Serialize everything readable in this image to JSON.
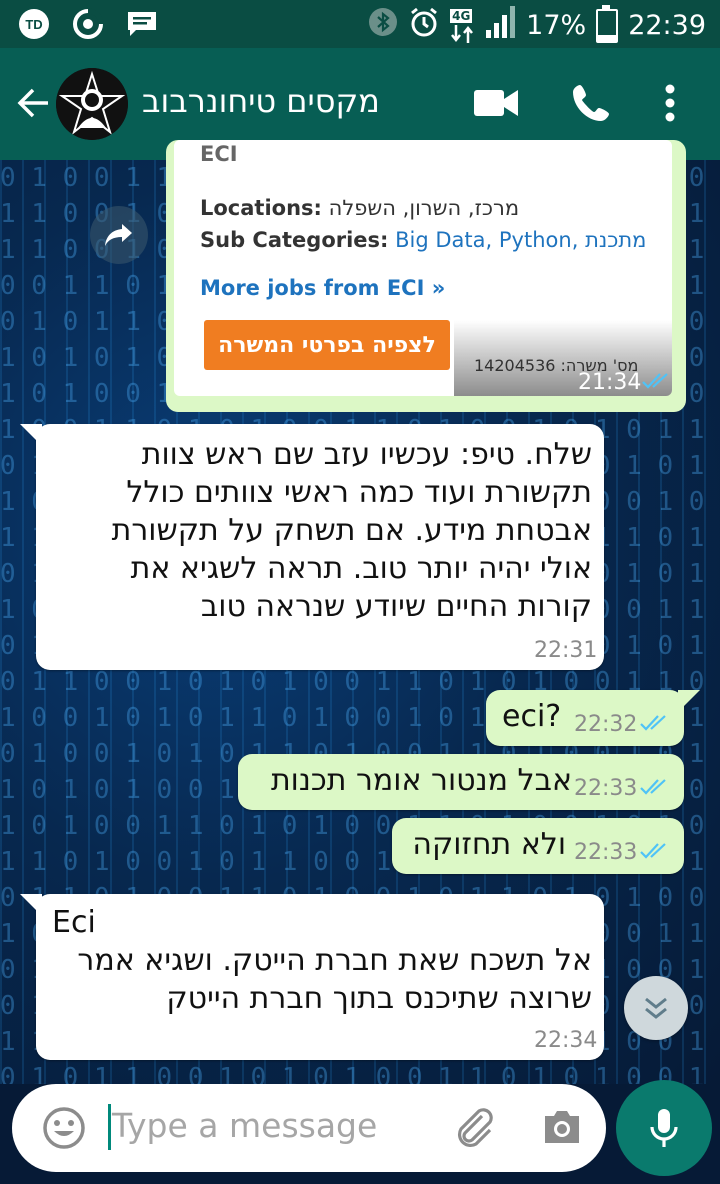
{
  "status_bar": {
    "battery_percent": "17%",
    "battery_level": 0.17,
    "time": "22:39",
    "network_label": "4G",
    "left_icons": [
      "app-notification-icon",
      "sync-icon",
      "message-icon"
    ],
    "right_icons": [
      "bluetooth-icon",
      "alarm-icon",
      "4g-data-icon",
      "signal-icon",
      "battery-icon"
    ]
  },
  "header": {
    "contact_name": "מקסים טיחונרבוב",
    "icons": [
      "back-arrow-icon",
      "avatar",
      "video-call-icon",
      "phone-call-icon",
      "more-options-icon"
    ]
  },
  "job_card": {
    "top_cut_text": "ECI",
    "locations_label": "Locations:",
    "locations_value": "מרכז, השרון, השפלה",
    "subcat_label": "Sub Categories:",
    "subcat_values": [
      "Big Data",
      "Python",
      "מתכנת"
    ],
    "more_jobs": "More jobs from ECI »",
    "apply_button": "לצפיה בפרטי המשרה",
    "job_id": "מס' משרה: 14204536",
    "time": "21:34"
  },
  "messages": [
    {
      "direction": "in",
      "text": "שלח. טיפ: עכשיו עזב שם ראש צוות תקשורת ועוד כמה ראשי צוותים כולל אבטחת מידע. אם תשחק על תקשורת אולי יהיה יותר טוב. תראה לשגיא את קורות החיים שיודע שנראה טוב",
      "time": "22:31"
    },
    {
      "direction": "out",
      "text": "eci?",
      "time": "22:32"
    },
    {
      "direction": "out",
      "text": "אבל מנטור אומר תכנות",
      "time": "22:33"
    },
    {
      "direction": "out",
      "text": "ולא תחזוקה",
      "time": "22:33"
    },
    {
      "direction": "in",
      "text_first": "Eci",
      "text": "אל תשכח שאת חברת הייטק. ושגיא אמר שרוצה שתיכנס בתוך חברת הייטק",
      "time": "22:34"
    }
  ],
  "input": {
    "placeholder": "Type a message"
  },
  "colors": {
    "header": "#075e54",
    "status_bar": "#0a4d43",
    "outgoing_bubble": "#dcf8c6",
    "incoming_bubble": "#ffffff",
    "read_ticks": "#4fc3f7",
    "apply_button": "#f07d21",
    "mic_button": "#0a7a6d"
  }
}
